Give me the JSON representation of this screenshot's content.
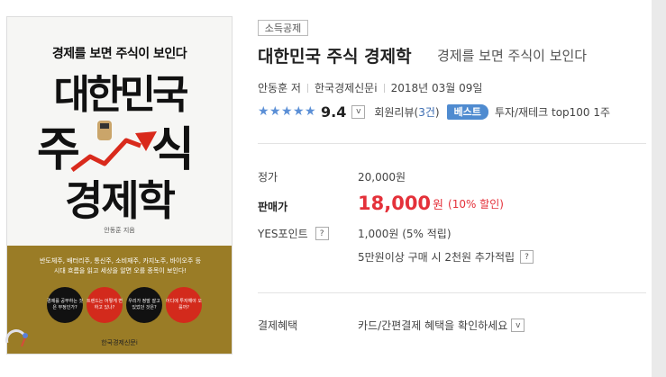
{
  "cover": {
    "subtitle": "경제를 보면 주식이 보인다",
    "title_line1": "대한민국",
    "title_line2_a": "주",
    "title_line2_b": "식",
    "title_line3": "경제학",
    "author": "안동훈 지음",
    "blurb_line1": "반도체주, 배터리주, 통신주, 소비재주, 카지노주, 바이오주 등",
    "blurb_line2": "시대 흐름을 읽고 세상을 알면 오를 종목이 보인다!",
    "circles": [
      "경제를 공부하는 것은 부정인가?",
      "트렌드는 어떻게 변하고 있나?",
      "우리가 정말 잘고 있었던 것은?",
      "어디에 투자해야 오를까?"
    ],
    "publisher": "한국경제신문i"
  },
  "badge_tax": "소득공제",
  "title": "대한민국 주식 경제학",
  "subtitle": "경제를 보면 주식이 보인다",
  "meta": {
    "author": "안동훈 저",
    "publisher": "한국경제신문i",
    "date": "2018년 03월 09일"
  },
  "rating": {
    "stars": 5,
    "score": "9.4",
    "dropdown": "v",
    "review_label": "회원리뷰(",
    "review_count": "3건",
    "review_close": ")",
    "best_badge": "베스트",
    "rank": "투자/재테크 top100 1주"
  },
  "price": {
    "list_label": "정가",
    "list_value": "20,000원",
    "sale_label": "판매가",
    "sale_value": "18,000",
    "sale_unit": "원",
    "sale_pct": "(10% 할인)",
    "points_label": "YES포인트",
    "points_help": "?",
    "points_value": "1,000원 (5% 적립)",
    "extra_points": "5만원이상 구매 시 2천원 추가적립",
    "extra_help": "?"
  },
  "payment": {
    "label": "결제혜택",
    "value": "카드/간편결제 혜택을 확인하세요",
    "dropdown": "v"
  },
  "colors": {
    "accent_blue": "#4f8bd0",
    "sale_red": "#e4313a",
    "cover_gold": "#9a7c26"
  }
}
